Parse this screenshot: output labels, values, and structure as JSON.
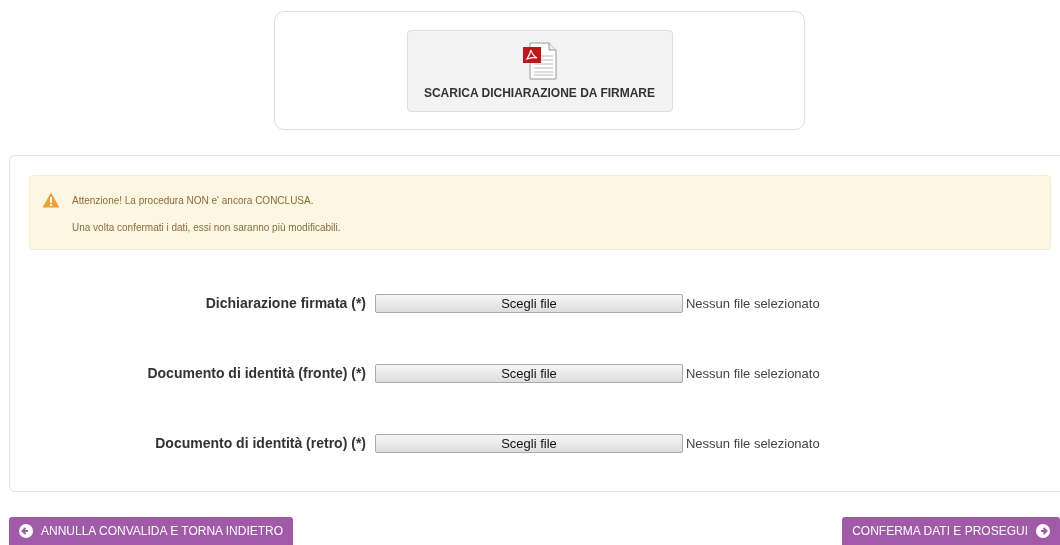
{
  "download_button": {
    "label": "SCARICA DICHIARAZIONE DA FIRMARE"
  },
  "alert": {
    "title": "Attenzione! La procedura NON e' ancora CONCLUSA.",
    "message": "Una volta confermati i dati, essi non saranno più modificabili."
  },
  "uploads": [
    {
      "label": "Dichiarazione firmata (*)",
      "button": "Scegli file",
      "status": "Nessun file selezionato"
    },
    {
      "label": "Documento di identità (fronte) (*)",
      "button": "Scegli file",
      "status": "Nessun file selezionato"
    },
    {
      "label": "Documento di identità (retro) (*)",
      "button": "Scegli file",
      "status": "Nessun file selezionato"
    }
  ],
  "actions": [
    {
      "label": "ANNULLA CONVALIDA E TORNA INDIETRO",
      "kind": "back"
    },
    {
      "label": "CONFERMA DATI E PROSEGUI",
      "kind": "next"
    }
  ]
}
